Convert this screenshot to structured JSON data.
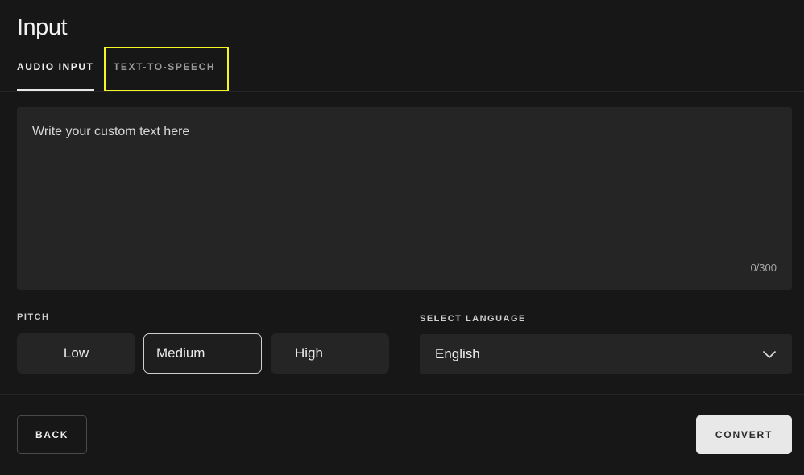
{
  "header": {
    "title": "Input"
  },
  "tabs": [
    {
      "label": "AUDIO INPUT",
      "active": true
    },
    {
      "label": "TEXT-TO-SPEECH",
      "active": false,
      "highlighted": true,
      "highlight_color": "#f5f523"
    }
  ],
  "text_input": {
    "placeholder": "Write your custom text here",
    "value": "",
    "counter": "0/300"
  },
  "pitch": {
    "label": "PITCH",
    "options": [
      "Low",
      "Medium",
      "High"
    ],
    "selected": "Medium"
  },
  "language": {
    "label": "SELECT LANGUAGE",
    "value": "English",
    "icon": "chevron-down-icon"
  },
  "footer": {
    "back_label": "BACK",
    "convert_label": "CONVERT"
  }
}
